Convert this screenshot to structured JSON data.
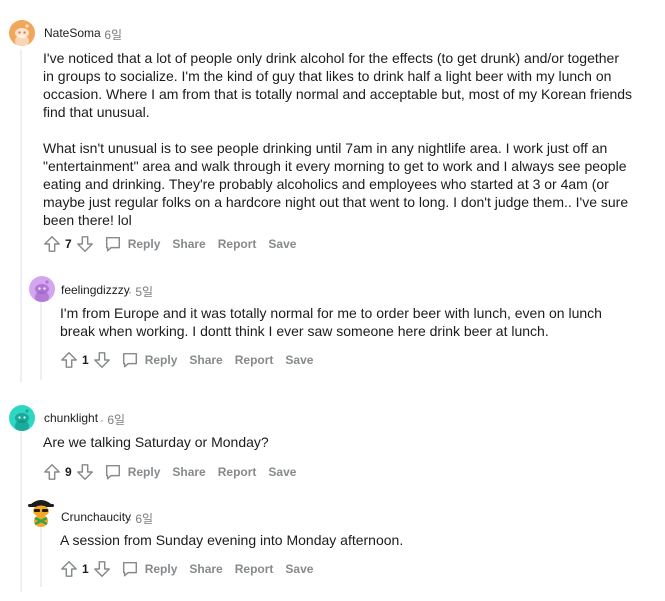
{
  "comments": [
    {
      "username": "NateSoma",
      "time": "6일",
      "paragraphs": [
        "I've noticed that a lot of people only drink alcohol for the effects (to get drunk) and/or together in groups to socialize. I'm the kind of guy that likes to drink half a light beer with my lunch on occasion. Where I am from that is totally normal and acceptable but, most of my Korean friends find that unusual.",
        "What isn't unusual is to see people drinking until 7am in any nightlife area. I work just off an \"entertainment\" area and walk through it every morning to get to work and I always see people eating and drinking. They're probably alcoholics and employees who started at 3 or 4am (or maybe just regular folks on a hardcore night out that went to long. I don't judge them.. I've sure been there! lol"
      ],
      "score": "7",
      "avatar_color": "#f2a65a"
    },
    {
      "username": "feelingdizzzy",
      "time": "5일",
      "paragraphs": [
        "I'm from Europe and it was totally normal for me to order beer with lunch, even on lunch break when working. I dontt think I ever saw someone here drink beer at lunch."
      ],
      "score": "1",
      "avatar_color": "#d4a6f0"
    },
    {
      "username": "chunklight",
      "time": "6일",
      "paragraphs": [
        "Are we talking Saturday or Monday?"
      ],
      "score": "9",
      "avatar_color": "#2fd6c3"
    },
    {
      "username": "Crunchaucity",
      "time": "6일",
      "paragraphs": [
        "A session from Sunday evening into Monday afternoon."
      ],
      "score": "1",
      "avatar_color": "#ffffff"
    }
  ],
  "actions": {
    "reply": "Reply",
    "share": "Share",
    "report": "Report",
    "save": "Save"
  },
  "separator": "·",
  "icons": [
    "upvote-icon",
    "downvote-icon",
    "comment-icon",
    "snoo-avatar"
  ]
}
